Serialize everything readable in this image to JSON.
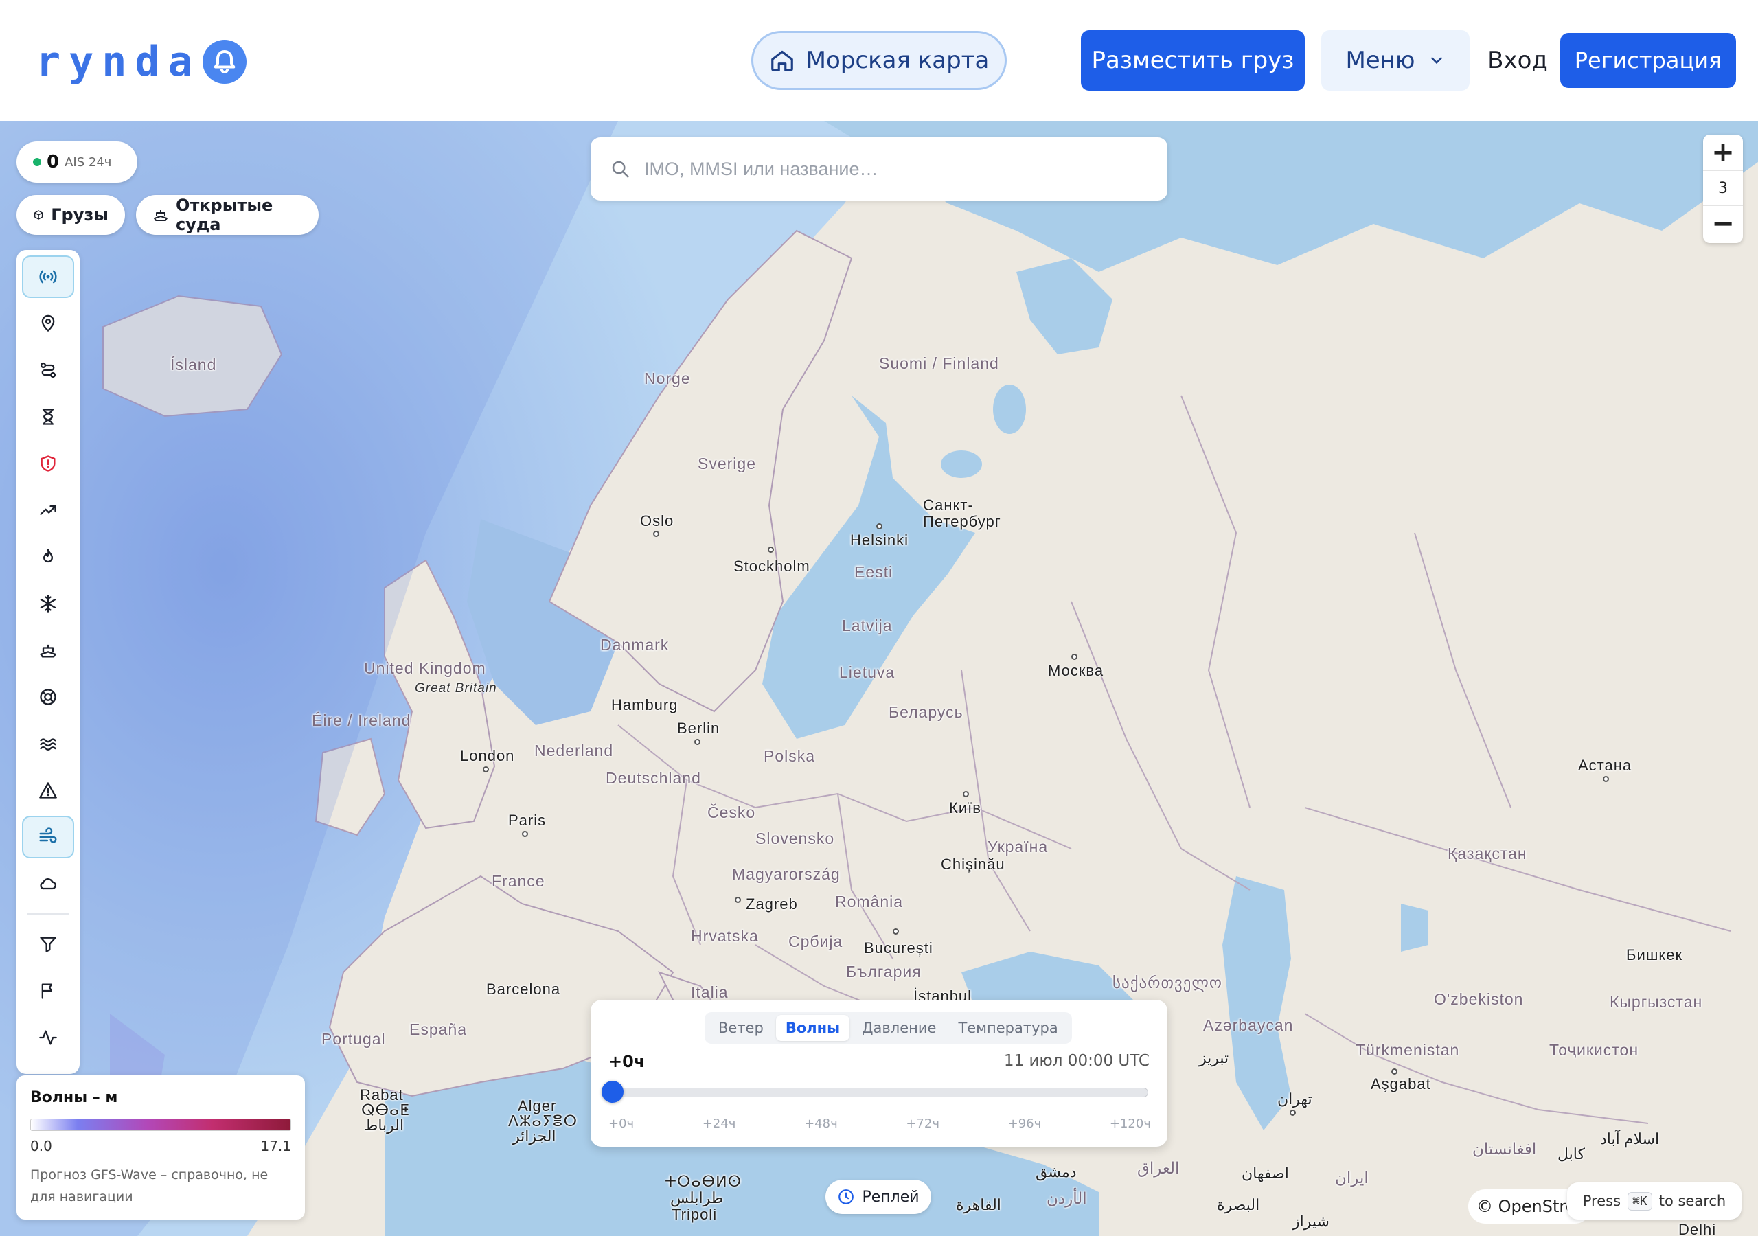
{
  "header": {
    "logo_text": "rynda",
    "sea_map_label": "Морская карта",
    "place_cargo_label": "Разместить груз",
    "menu_label": "Меню",
    "login_label": "Вход",
    "register_label": "Регистрация"
  },
  "ais": {
    "count": "0",
    "label": "AIS 24ч",
    "status_color": "#19b36b"
  },
  "filters": {
    "cargo_label": "Грузы",
    "open_vessels_label": "Открытые суда"
  },
  "search": {
    "placeholder": "IMO, MMSI или название…"
  },
  "zoom": {
    "level": "3",
    "plus": "+",
    "minus": "−"
  },
  "toolbar": {
    "tools": [
      {
        "icon": "ais-broadcast-icon",
        "active": true
      },
      {
        "icon": "map-pin-icon"
      },
      {
        "icon": "route-icon"
      },
      {
        "icon": "hourglass-icon"
      },
      {
        "icon": "shield-alert-icon",
        "color": "#e0243a"
      },
      {
        "icon": "trending-up-icon"
      },
      {
        "icon": "flame-icon"
      },
      {
        "icon": "snowflake-icon"
      },
      {
        "icon": "ship-icon"
      },
      {
        "icon": "lifebuoy-icon"
      },
      {
        "icon": "waves-icon"
      },
      {
        "icon": "warning-triangle-icon"
      },
      {
        "icon": "wind-icon",
        "active": true
      },
      {
        "icon": "cloud-icon"
      },
      {
        "icon": "filter-icon"
      },
      {
        "icon": "flag-icon"
      },
      {
        "icon": "activity-icon"
      }
    ]
  },
  "legend": {
    "title": "Волны – м",
    "min": "0.0",
    "max": "17.1",
    "note": "Прогноз GFS-Wave – справочно, не для навигации",
    "colors": [
      "#ffffff",
      "#7b7ff0",
      "#b248b8",
      "#c22e6f",
      "#8e1a3a"
    ]
  },
  "timeline": {
    "tabs": [
      "Ветер",
      "Волны",
      "Давление",
      "Температура"
    ],
    "active_tab": "Волны",
    "offset_label": "+0ч",
    "datetime": "11 июл 00:00 UTC",
    "progress": 0,
    "ticks": [
      "+0ч",
      "+24ч",
      "+48ч",
      "+72ч",
      "+96ч",
      "+120ч"
    ]
  },
  "replay_label": "Реплей",
  "attribution": "© OpenStreetMap",
  "search_hint": {
    "press": "Press",
    "key": "⌘K",
    "suffix": "to search"
  },
  "map_labels": [
    "Ísland",
    "Norge",
    "Sverige",
    "Suomi / Finland",
    "Oslo",
    "Stockholm",
    "Helsinki",
    "Санкт-Петербург",
    "Eesti",
    "Latvija",
    "Lietuva",
    "Danmark",
    "United Kingdom",
    "Great Britain",
    "Éire / Ireland",
    "London",
    "Hamburg",
    "Berlin",
    "Nederland",
    "Deutschland",
    "Polska",
    "Беларусь",
    "Москва",
    "Київ",
    "Україна",
    "Česko",
    "Slovensko",
    "Paris",
    "France",
    "Magyarország",
    "Chişinău",
    "Zagreb",
    "România",
    "Hrvatska",
    "Србија",
    "București",
    "България",
    "Italia",
    "Barcelona",
    "España",
    "Portugal",
    "Rabat",
    "ⵕⴱⴰⵟ",
    "الرباط",
    "Alger",
    "ⴷⵣⴰⵢⴻⵔ",
    "الجزائر",
    "Tripoli",
    "طرابلس",
    "ⵜⵔⴰⴱⵍⵙ",
    "القاهرة",
    "İstanbul",
    "საქართველო",
    "Azərbaycan",
    "Türkmenistan",
    "Aşgabat",
    "Қазақстан",
    "Астана",
    "O'zbekiston",
    "Кыргызстан",
    "Бишкек",
    "Тоҷикистон",
    "تبریز",
    "تهران",
    "ایران",
    "العراق",
    "دمشق",
    "الأردن",
    "اصفهان",
    "البصرة",
    "شیراز",
    "افغانستان",
    "کابل",
    "اسلام آباد",
    "Delhi"
  ]
}
